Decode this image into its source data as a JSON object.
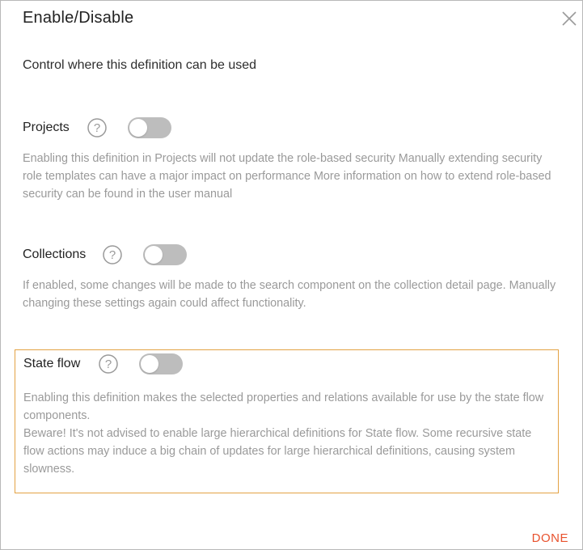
{
  "dialog": {
    "title": "Enable/Disable",
    "subtitle": "Control where this definition can be used",
    "done_label": "DONE",
    "accent_color": "#e8522e",
    "highlight_border_color": "#e3a244"
  },
  "sections": {
    "projects": {
      "label": "Projects",
      "enabled": false,
      "description": "Enabling this definition in Projects will not update the role-based security Manually extending security role templates can have a major impact on performance More information on how to extend role-based security can be found in the user manual"
    },
    "collections": {
      "label": "Collections",
      "enabled": false,
      "description": "If enabled, some changes will be made to the search component on the collection detail page. Manually changing these settings again could affect functionality."
    },
    "state_flow": {
      "label": "State flow",
      "enabled": false,
      "description_1": "Enabling this definition makes the selected properties and relations available for use by the state flow components.",
      "description_2": "Beware! It's not advised to enable large hierarchical definitions for State flow. Some recursive state flow actions may induce a big chain of updates for large hierarchical definitions, causing system slowness."
    }
  },
  "icons": {
    "close": "close-icon",
    "help": "help-circle-icon"
  }
}
